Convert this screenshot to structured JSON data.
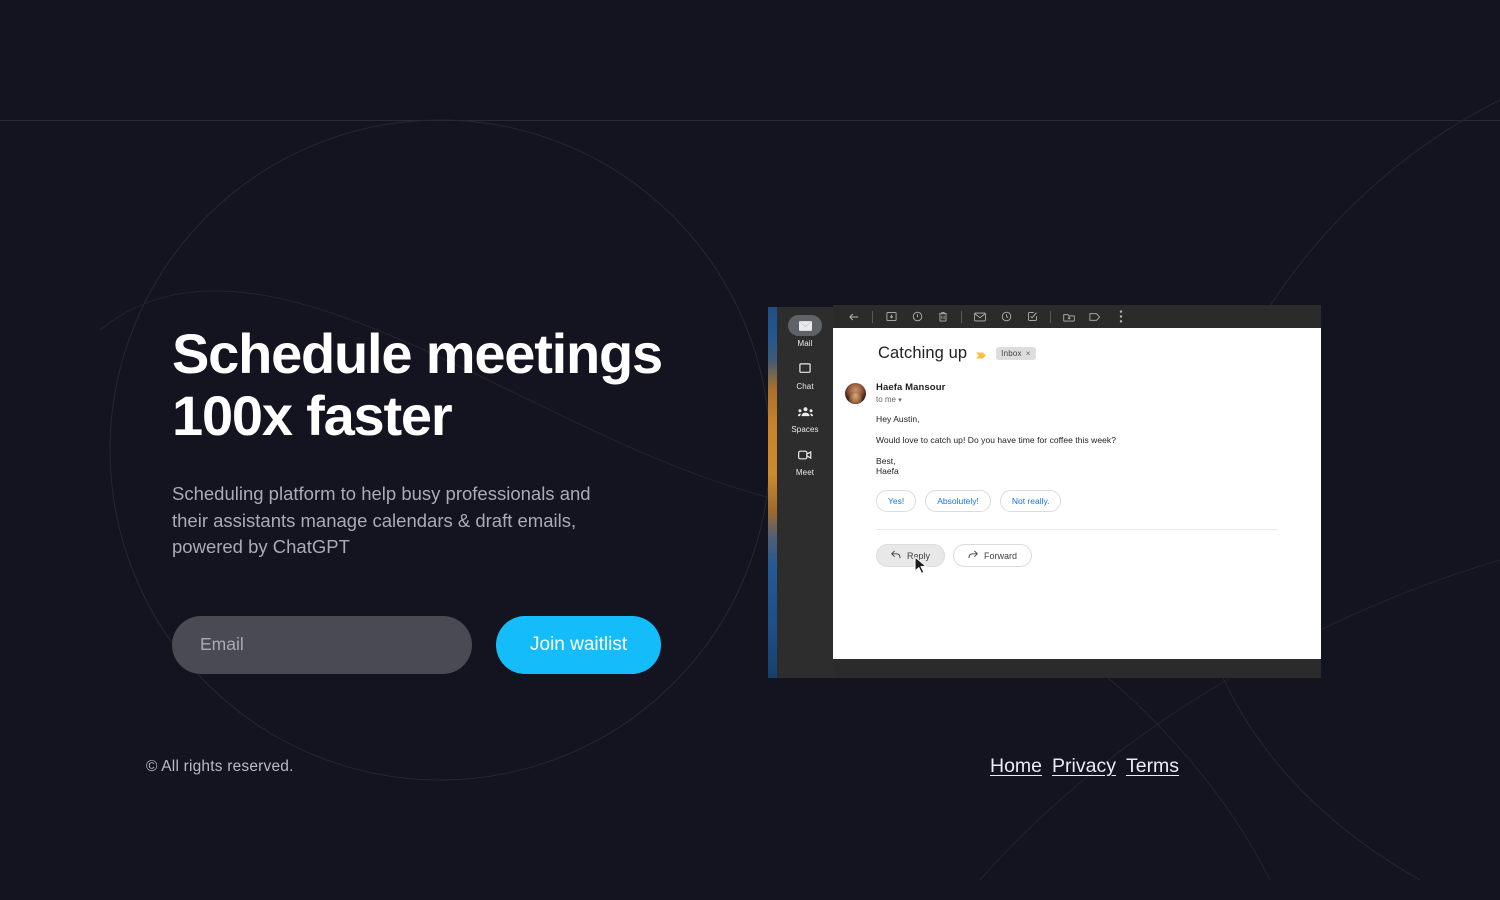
{
  "theme": {
    "background": "#141320",
    "accent": "#14bdf9",
    "input_bg": "#4a4a52",
    "text_primary": "#ffffff",
    "text_muted": "#a9abb5",
    "gmail_blue": "#1a73e8"
  },
  "hero": {
    "headline": "Schedule meetings\n100x faster",
    "subhead": "Scheduling platform to help busy professionals and\ntheir assistants manage calendars & draft emails,\npowered by ChatGPT",
    "email_placeholder": "Email",
    "email_value": "",
    "cta_label": "Join waitlist"
  },
  "footer": {
    "copyright": "© All rights reserved.",
    "links": [
      {
        "label": "Home"
      },
      {
        "label": "Privacy"
      },
      {
        "label": "Terms"
      }
    ]
  },
  "gmail": {
    "rail": [
      {
        "label": "Mail",
        "icon": "mail-icon",
        "active": true
      },
      {
        "label": "Chat",
        "icon": "chat-icon",
        "active": false
      },
      {
        "label": "Spaces",
        "icon": "spaces-icon",
        "active": false
      },
      {
        "label": "Meet",
        "icon": "meet-icon",
        "active": false
      }
    ],
    "toolbar": [
      {
        "icon": "back-arrow-icon"
      },
      {
        "icon": "archive-icon"
      },
      {
        "icon": "report-spam-icon"
      },
      {
        "icon": "delete-icon"
      },
      {
        "icon": "mark-unread-icon"
      },
      {
        "icon": "snooze-icon"
      },
      {
        "icon": "add-to-tasks-icon"
      },
      {
        "icon": "move-to-icon"
      },
      {
        "icon": "label-icon"
      },
      {
        "icon": "more-options-icon"
      }
    ],
    "message": {
      "subject": "Catching up",
      "important_marker": "important-marker-icon",
      "label_chip": "Inbox",
      "label_chip_close": "×",
      "sender_name": "Haefa Mansour",
      "recipient": "to me",
      "recipient_caret": "▾",
      "greeting": "Hey Austin,",
      "body": "Would love to catch up! Do you have time for coffee this week?",
      "closing": "Best,",
      "signature": "Haefa"
    },
    "smart_replies": [
      {
        "label": "Yes!"
      },
      {
        "label": "Absolutely!"
      },
      {
        "label": "Not really."
      }
    ],
    "actions": [
      {
        "label": "Reply",
        "icon": "reply-arrow-icon",
        "hovered": true
      },
      {
        "label": "Forward",
        "icon": "forward-arrow-icon",
        "hovered": false
      }
    ]
  }
}
